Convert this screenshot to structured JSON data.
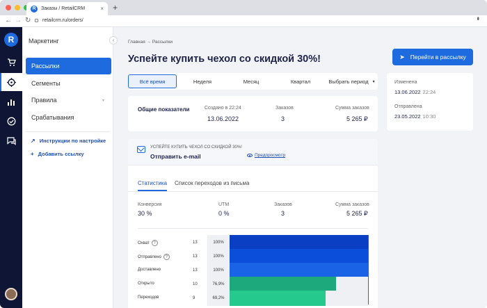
{
  "browser": {
    "tab_title": "Заказы / RetailCRM",
    "url": "retailcrm.ru/orders/",
    "new_tab": "+",
    "tab_close": "×",
    "back": "←",
    "forward": "→",
    "reload": "↻"
  },
  "sidebar": {
    "title": "Маркетинг",
    "collapse": "‹",
    "items": [
      {
        "label": "Рассылки",
        "active": true
      },
      {
        "label": "Сегменты",
        "active": false
      },
      {
        "label": "Правила",
        "active": false,
        "chevron": "▾"
      },
      {
        "label": "Срабатывания",
        "active": false
      }
    ],
    "links": [
      {
        "label": "Инструкции по настройке",
        "icon": "↗"
      },
      {
        "label": "Добавить ссылку",
        "icon": "+"
      }
    ]
  },
  "rail": {
    "logo": "R",
    "icons": [
      "cart-icon",
      "target-icon",
      "chart-icon",
      "check-circle-icon",
      "chat-icon"
    ]
  },
  "main": {
    "breadcrumb": "Главная → Рассылки",
    "title": "Успейте купить чехол со скидкой 30%!",
    "cta": "Перейти в рассылку",
    "cta_icon": "➤",
    "periods": [
      "Всё время",
      "Неделя",
      "Месяц",
      "Квартал",
      "Выбрать период"
    ],
    "period_dropdown": "▾",
    "info": {
      "changed_label": "Изменена",
      "changed_date": "13.06.2022",
      "changed_time": "22:24",
      "sent_label": "Отправлена",
      "sent_date": "23.05.2022",
      "sent_time": "10:30"
    },
    "overview": {
      "title": "Общие показатели",
      "created_label": "Создано в 22:24",
      "created_value": "13.06.2022",
      "orders_label": "Заказов",
      "orders_value": "3",
      "sum_label": "Сумма заказов",
      "sum_value": "5 265 ₽"
    },
    "email": {
      "subject": "УСПЕЙТЕ КУПИТЬ ЧЕХОЛ СО СКИДКОЙ 30%!",
      "action": "Отправить e-mail",
      "preview": "Предпросмотр",
      "tabs": [
        "Статистика",
        "Список переходов из письма"
      ],
      "stats": [
        {
          "label": "Конверсия",
          "value": "30 %"
        },
        {
          "label": "UTM",
          "value": "0 %"
        },
        {
          "label": "Заказов",
          "value": "3"
        },
        {
          "label": "Сумма заказов",
          "value": "5 265 ₽"
        }
      ],
      "funnel": [
        {
          "label": "Охват",
          "count": "13",
          "pct": "100%",
          "fill": 1.0,
          "color": "#0a3fc4",
          "help": true
        },
        {
          "label": "Отправлено",
          "count": "13",
          "pct": "100%",
          "fill": 1.0,
          "color": "#0a4ed9",
          "help": true
        },
        {
          "label": "Доставлено",
          "count": "13",
          "pct": "100%",
          "fill": 1.0,
          "color": "#1a62e6",
          "help": false
        },
        {
          "label": "Открыто",
          "count": "10",
          "pct": "76,9%",
          "fill": 0.769,
          "color": "#1ea97c",
          "help": false
        },
        {
          "label": "Переходов",
          "count": "9",
          "pct": "69,2%",
          "fill": 0.692,
          "color": "#25c98d",
          "help": false
        }
      ],
      "help_mark": "?"
    }
  },
  "colors": {
    "accent": "#1e6be0",
    "rail": "#0f1535",
    "green": "#1ea97c"
  }
}
